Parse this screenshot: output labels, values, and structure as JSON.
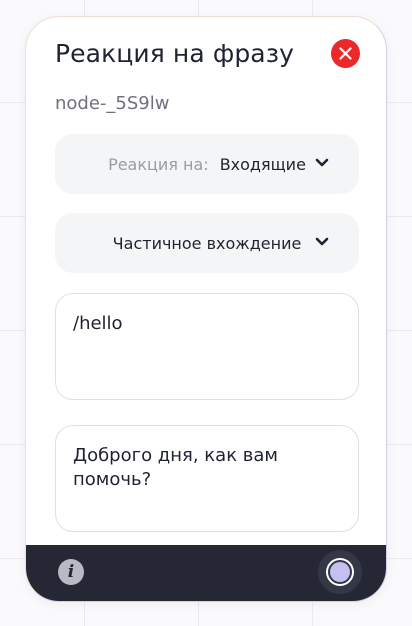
{
  "panel": {
    "title": "Реакция на фразу",
    "node_id": "node-_5S9lw",
    "close_icon": "close-x-icon",
    "close_color": "#ea2a2a"
  },
  "reaction_select": {
    "label": "Реакция на:",
    "value": "Входящие",
    "icon": "chevron-down-icon"
  },
  "match_select": {
    "value": "Частичное вхождение",
    "icon": "chevron-down-icon"
  },
  "phrase_input": {
    "value": "/hello"
  },
  "response_input": {
    "value": "Доброго дня, как вам помочь?"
  },
  "footer": {
    "info_icon": "info-icon",
    "info_glyph": "i",
    "toggle_icon": "radio-toggle-icon",
    "toggle_color": "#c5c0f2",
    "background": "#252834"
  }
}
